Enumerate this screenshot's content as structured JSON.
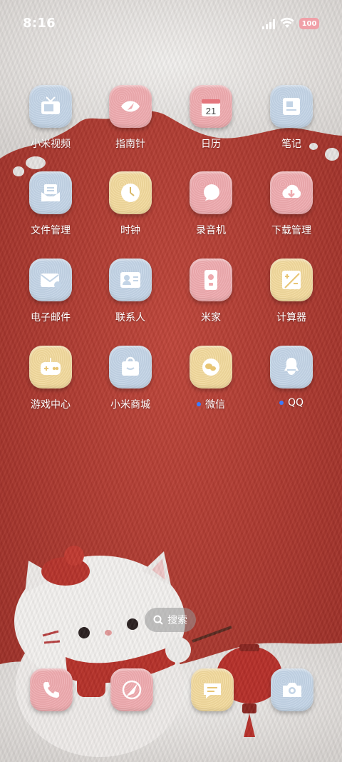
{
  "status_bar": {
    "time": "8:16",
    "battery": "100"
  },
  "apps": [
    {
      "label": "小米视频",
      "icon": "tv-icon",
      "color": "blue",
      "dot": false
    },
    {
      "label": "指南针",
      "icon": "compass-icon",
      "color": "pink",
      "dot": false
    },
    {
      "label": "日历",
      "icon": "calendar-icon",
      "color": "pink",
      "dot": false,
      "day": "21"
    },
    {
      "label": "笔记",
      "icon": "notes-icon",
      "color": "blue",
      "dot": false
    },
    {
      "label": "文件管理",
      "icon": "folder-icon",
      "color": "blue",
      "dot": false
    },
    {
      "label": "时钟",
      "icon": "clock-icon",
      "color": "yellow",
      "dot": false
    },
    {
      "label": "录音机",
      "icon": "recorder-icon",
      "color": "pink",
      "dot": false
    },
    {
      "label": "下载管理",
      "icon": "download-icon",
      "color": "pink",
      "dot": false
    },
    {
      "label": "电子邮件",
      "icon": "mail-icon",
      "color": "blue",
      "dot": false
    },
    {
      "label": "联系人",
      "icon": "contacts-icon",
      "color": "blue",
      "dot": false
    },
    {
      "label": "米家",
      "icon": "mihome-icon",
      "color": "pink",
      "dot": false
    },
    {
      "label": "计算器",
      "icon": "calculator-icon",
      "color": "yellow",
      "dot": false
    },
    {
      "label": "游戏中心",
      "icon": "gamepad-icon",
      "color": "yellow",
      "dot": false
    },
    {
      "label": "小米商城",
      "icon": "shop-icon",
      "color": "blue",
      "dot": false
    },
    {
      "label": "微信",
      "icon": "wechat-icon",
      "color": "yellow",
      "dot": true
    },
    {
      "label": "QQ",
      "icon": "qq-icon",
      "color": "blue",
      "dot": true
    }
  ],
  "search": {
    "label": "搜索"
  },
  "dock": [
    {
      "icon": "phone-icon",
      "color": "pink"
    },
    {
      "icon": "browser-icon",
      "color": "pink"
    },
    {
      "icon": "messages-icon",
      "color": "yellow"
    },
    {
      "icon": "camera-icon",
      "color": "blue"
    }
  ],
  "colors": {
    "wallpaper_red": "#b53a30",
    "fur_white": "#e9e6e4",
    "notify_dot": "#3b7bff"
  }
}
